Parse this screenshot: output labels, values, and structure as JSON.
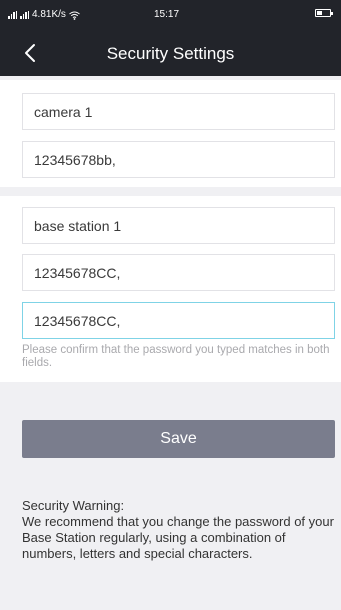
{
  "status_bar": {
    "network_speed": "4.81K/s",
    "time": "15:17"
  },
  "header": {
    "title": "Security Settings",
    "back_icon": "chevron-left-icon"
  },
  "camera": {
    "name": "camera 1",
    "password": "12345678bb,"
  },
  "base_station": {
    "name": "base station 1",
    "password": "12345678CC,",
    "confirm_password": "12345678CC,",
    "hint": "Please confirm that the password you typed matches in both fields."
  },
  "save_label": "Save",
  "warning": {
    "title": "Security Warning:",
    "body": "We recommend that you change the password of your Base Station regularly, using a combination of numbers, letters and special characters."
  },
  "colors": {
    "header_bg": "#22242a",
    "page_bg": "#f0f0f3",
    "button_bg": "#7a7d8d",
    "focus_border": "#7fd3e6"
  }
}
